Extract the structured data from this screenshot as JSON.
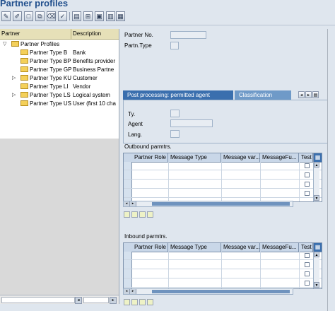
{
  "app": {
    "title": "Partner profiles"
  },
  "toolbar": {
    "buttons": [
      {
        "name": "display-icon",
        "glyph": "✎"
      },
      {
        "name": "change-icon",
        "glyph": "✐"
      },
      {
        "name": "create-icon",
        "glyph": "□"
      },
      {
        "name": "copy-icon",
        "glyph": "⧉"
      },
      {
        "name": "delete-icon",
        "glyph": "🗑"
      },
      {
        "name": "check-icon",
        "glyph": "✓"
      },
      {
        "name": "hierarchy-icon",
        "glyph": "▤"
      },
      {
        "name": "org-icon",
        "glyph": "⊞"
      },
      {
        "name": "details-icon",
        "glyph": "▣"
      },
      {
        "name": "list-icon",
        "glyph": "▥"
      }
    ]
  },
  "tree": {
    "col_partner": "Partner",
    "col_description": "Description",
    "root": "Partner Profiles",
    "items": [
      {
        "label": "Partner Type B",
        "desc": "Bank",
        "expandable": false
      },
      {
        "label": "Partner Type BP",
        "desc": "Benefits provider",
        "expandable": false
      },
      {
        "label": "Partner Type GP",
        "desc": "Business Partne",
        "expandable": false
      },
      {
        "label": "Partner Type KU",
        "desc": "Customer",
        "expandable": true
      },
      {
        "label": "Partner Type LI",
        "desc": "Vendor",
        "expandable": false
      },
      {
        "label": "Partner Type LS",
        "desc": "Logical system",
        "expandable": true
      },
      {
        "label": "Partner Type US",
        "desc": "User (first 10 cha",
        "expandable": false
      }
    ]
  },
  "form": {
    "partner_no_label": "Partner No.",
    "partner_no_value": "",
    "partn_type_label": "Partn.Type",
    "partn_type_value": ""
  },
  "tabs": {
    "active": "Post processing: permitted agent",
    "inactive": "Classification",
    "fields": {
      "ty_label": "Ty.",
      "agent_label": "Agent",
      "lang_label": "Lang."
    }
  },
  "outbound": {
    "title": "Outbound parmtrs.",
    "columns": [
      "Partner Role",
      "Message Type",
      "Message var...",
      "MessageFu...",
      "Test"
    ]
  },
  "inbound": {
    "title": "Inbound parmtrs.",
    "columns": [
      "Partner Role",
      "Message Type",
      "Message var...",
      "MessageFu...",
      "Test"
    ]
  },
  "colors": {
    "tab_active": "#3a6fae",
    "tab_inactive": "#6f9ac8",
    "grid_header": "#c9d7e8",
    "tree_header": "#e6e0b8"
  }
}
